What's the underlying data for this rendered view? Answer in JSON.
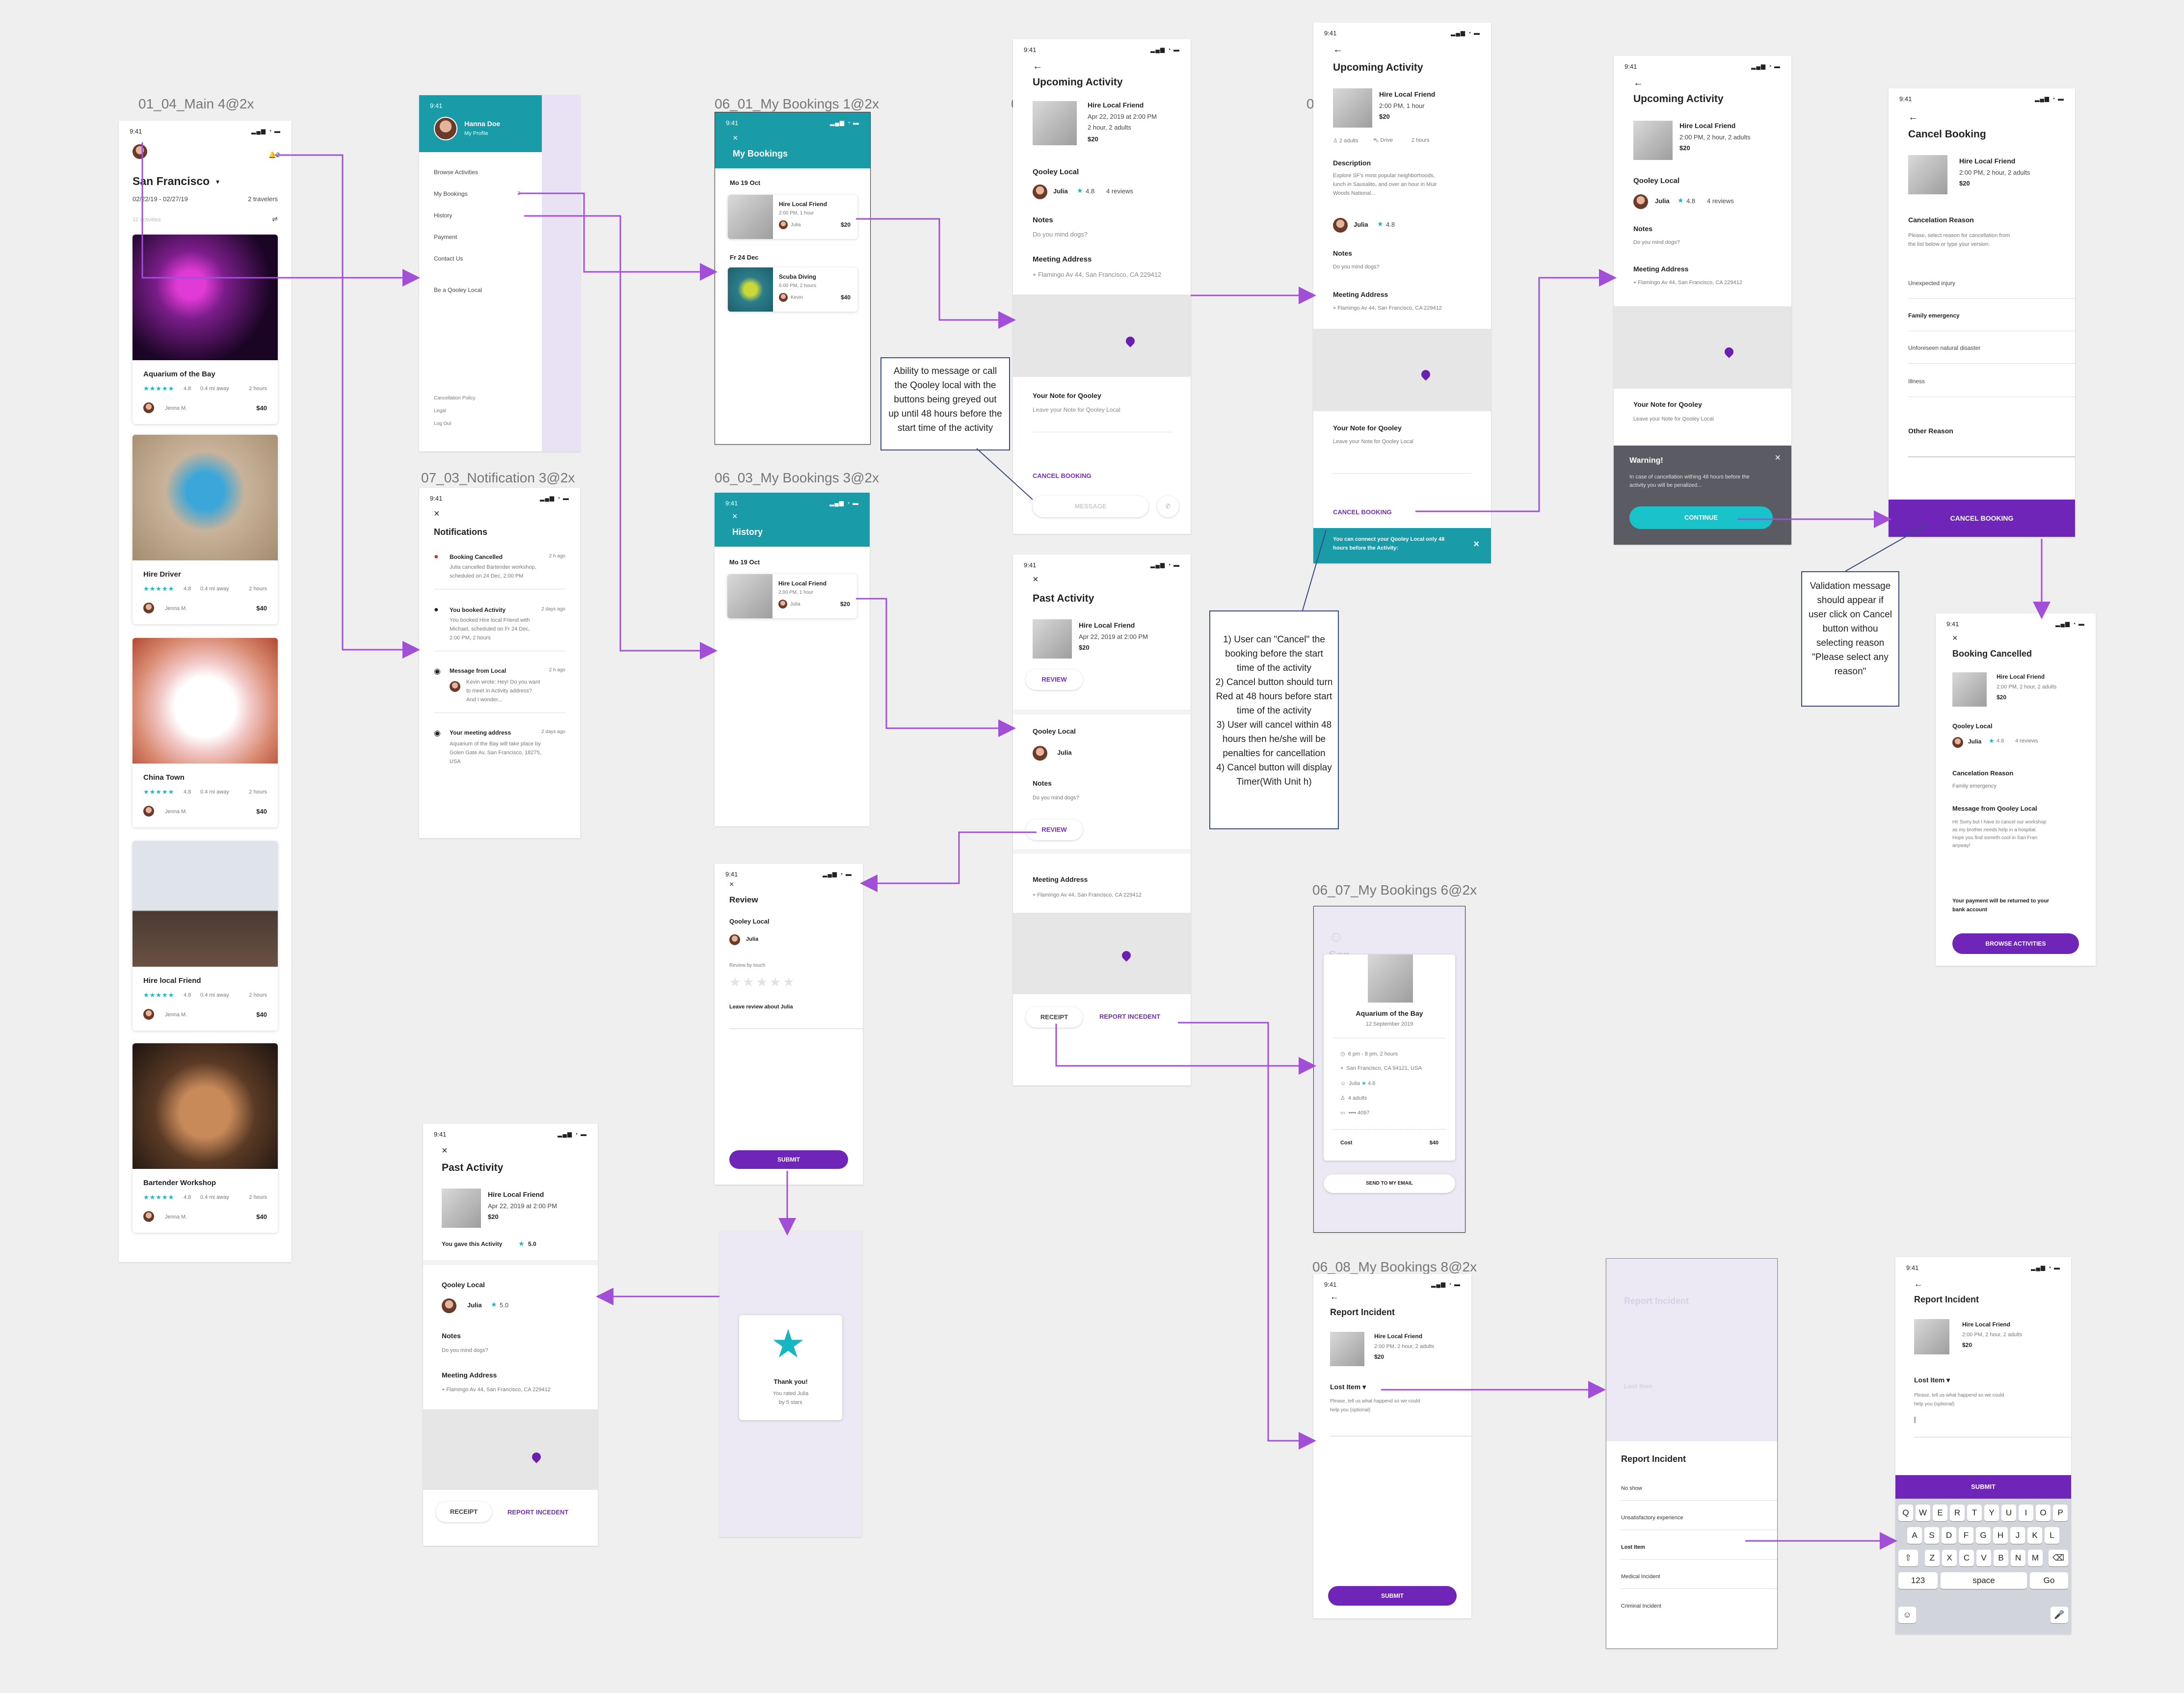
{
  "labels": {
    "main": "01_04_Main 4@2x",
    "b1": "06_01_My Bookings 1@2x",
    "notif": "07_03_Notification 3@2x",
    "b3": "06_03_My Bookings 3@2x",
    "b6": "06_07_My Bookings 6@2x",
    "b8": "06_08_My Bookings 8@2x",
    "stray1": "0",
    "stray2": "0"
  },
  "common": {
    "time": "9:41",
    "signal": "▂▄▆ ◔ ▬",
    "hire_local": "Hire Local Friend",
    "qooley_local": "Qooley Local",
    "julia": "Julia",
    "rating": "4.8",
    "reviews": "4 reviews",
    "notes": "Notes",
    "notes_q": "Do you mind dogs?",
    "meeting": "Meeting Address",
    "address": "Flamingo Av 44, San Francisco, CA 229412",
    "note_for": "Your Note for Qooley",
    "note_ph": "Leave your Note for Qooley Local",
    "cancel_booking": "CANCEL BOOKING",
    "message": "MESSAGE",
    "receipt": "RECEIPT",
    "report_incident": "REPORT INCEDENT",
    "review": "REVIEW",
    "submit": "SUBMIT",
    "price": "$20",
    "back": "←",
    "close": "×"
  },
  "main": {
    "city": "San Francisco",
    "dates": "02/22/19 - 02/27/19",
    "travelers": "2 travelers",
    "activities_count": "12 activities",
    "bell_count": "2",
    "cards": [
      {
        "title": "Aquarium of the Bay",
        "rating": "4.8",
        "dist": "0.4 mi away",
        "dur": "2 hours",
        "host": "Jenna M.",
        "price": "$40"
      },
      {
        "title": "Hire Driver",
        "rating": "4.8",
        "dist": "0.4 mi away",
        "dur": "2 hours",
        "host": "Jenna M.",
        "price": "$40"
      },
      {
        "title": "China Town",
        "rating": "4.8",
        "dist": "0.4 mi away",
        "dur": "2 hours",
        "host": "Jenna M.",
        "price": "$40"
      },
      {
        "title": "Hire local Friend",
        "rating": "4.8",
        "dist": "0.4 mi away",
        "dur": "2 hours",
        "host": "Jenna M.",
        "price": "$40"
      },
      {
        "title": "Bartender Workshop",
        "rating": "4.8",
        "dist": "0.4 mi away",
        "dur": "2 hours",
        "host": "Jenna M.",
        "price": "$40"
      }
    ]
  },
  "menu": {
    "name": "Hanna Doe",
    "profile": "My Profile",
    "items": [
      "Browse Activities",
      "My Bookings",
      "History",
      "Payment",
      "Contact Us",
      "Be a Qooley Local"
    ],
    "badge": "2",
    "footer": [
      "Cancellation Policy",
      "Legal",
      "Log Out"
    ]
  },
  "bookings1": {
    "title": "My Bookings",
    "d1": "Mo 19 Oct",
    "i1_title": "Hire Local Friend",
    "i1_time": "2:00 PM, 1 hour",
    "i1_host": "Julia",
    "i1_price": "$20",
    "d2": "Fr 24 Dec",
    "i2_title": "Scuba Diving",
    "i2_time": "6:00 PM, 2 hours",
    "i2_host": "Kevin",
    "i2_price": "$40"
  },
  "notifications": {
    "title": "Notifications",
    "items": [
      {
        "title": "Booking Cancelled",
        "time": "2 h ago",
        "body1": "Julia cancelled Bartender workshop,",
        "body2": "scheduled on 24 Dec, 2:00 PM"
      },
      {
        "title": "You booked Activity",
        "time": "2 days ago",
        "body1": "You booked Hire local Friend with",
        "body2": "Michael, scheduled on Fr 24 Dec,",
        "body3": "2:00 PM, 2 hours"
      },
      {
        "title": "Message from Local",
        "time": "2 h ago",
        "body1": "Kevin wrote: Hey! Do you want",
        "body2": "to meet in Activity address?",
        "body3": "And I wonder..."
      },
      {
        "title": "Your meeting address",
        "time": "2 days ago",
        "body1": "Aquarium of the Bay will take place by",
        "body2": "Golen Gate Av, San Francisco, 18275,",
        "body3": "USA"
      }
    ]
  },
  "history": {
    "title": "History",
    "d1": "Mo 19 Oct",
    "i1_title": "Hire Local Friend",
    "i1_time": "2:00 PM, 1 hour",
    "i1_host": "Julia",
    "i1_price": "$20"
  },
  "upcoming1": {
    "title": "Upcoming Activity",
    "date": "Apr 22, 2019 at 2:00 PM",
    "dur": "2 hour, 2 adults"
  },
  "upcoming2": {
    "title": "Upcoming Activity",
    "time": "2:00 PM, 1 hour",
    "adults": "2 adults",
    "drive": "Drive",
    "hours": "2 hours",
    "desc_h": "Description",
    "desc1": "Explore SF's most popular neighborhoods,",
    "desc2": "lunch in Sausalito, and over an hour in Muir",
    "desc3": "Woods National...",
    "toast": "You can connect your Qooley Local only 48 hours before the Activity:"
  },
  "upcoming3": {
    "title": "Upcoming Activity",
    "time": "2:00 PM, 2 hour, 2 adults",
    "warn_title": "Warning!",
    "warn_body": "In case of cancellation withing 48 hours before the activity you will be penalized...",
    "continue": "CONTINUE"
  },
  "cancel": {
    "title": "Cancel Booking",
    "time": "2:00 PM, 2 hour, 2 adults",
    "reason_h": "Cancelation Reason",
    "reason_p1": "Please, select reason for cancellation from",
    "reason_p2": "the list below or type your version:",
    "reasons": [
      "Unexpected injury",
      "Family emergency",
      "Unforeseen natural disaster",
      "Illness"
    ],
    "other": "Other Reason"
  },
  "cancelled": {
    "title": "Booking Cancelled",
    "time": "2:00 PM, 2 hour, 2 adults",
    "reason_h": "Cancelation Reason",
    "reason": "Family emergency",
    "msg_h": "Message from Qooley Local",
    "msg1": "Hi! Sorry but I have to cancel our workshop",
    "msg2": "as my brother needs help in a hospital.",
    "msg3": "Hope you find someth cool in San Fran",
    "msg4": "anyway!",
    "refund1": "Your payment will be returned to your",
    "refund2": "bank account",
    "browse": "BROWSE ACTIVITIES"
  },
  "past1": {
    "title": "Past Activity",
    "date": "Apr 22, 2019 at 2:00 PM"
  },
  "past2": {
    "title": "Past Activity",
    "date": "Apr 22, 2019 at 2:00 PM",
    "gave": "You gave this Activity",
    "score": "5.0"
  },
  "review": {
    "title": "Review",
    "by": "Review by touch",
    "leave": "Leave review about Julia"
  },
  "thanks": {
    "t1": "Thank you!",
    "t2": "You rated Julia",
    "t3": "by 5 stars"
  },
  "ticket": {
    "title": "Aquarium of the Bay",
    "date": "12 September 2019",
    "time": "6 pm - 8 pm, 2 hours",
    "addr": "San Francisco, CA 94121, USA",
    "host": "Julia",
    "adults": "4 adults",
    "card": "•••• 4097",
    "cost_l": "Cost",
    "cost": "$40",
    "send": "SEND TO MY EMAIL",
    "bg": "San"
  },
  "report1": {
    "title": "Report Incident",
    "time": "2:00 PM, 2 hour, 2 adults",
    "lost": "Lost Item",
    "lost_p1": "Please, tell us what happend so we could",
    "lost_p2": "help you (optional)"
  },
  "reportlist": {
    "title": "Report Incident",
    "items": [
      "No show",
      "Unsatisfactory experience",
      "Lost Item",
      "Medical Incident",
      "Criminal Incident"
    ],
    "bg_title": "Report Incident",
    "bg_lost": "Lost Item"
  },
  "report2": {
    "title": "Report Incident",
    "time": "2:00 PM, 2 hour, 2 adults",
    "lost": "Lost Item",
    "lost_p1": "Please, tell us what happend so we could",
    "lost_p2": "help you (optional)",
    "row1": [
      "Q",
      "W",
      "E",
      "R",
      "T",
      "Y",
      "U",
      "I",
      "O",
      "P"
    ],
    "row2": [
      "A",
      "S",
      "D",
      "F",
      "G",
      "H",
      "J",
      "K",
      "L"
    ],
    "row3": [
      "Z",
      "X",
      "C",
      "V",
      "B",
      "N",
      "M"
    ],
    "k123": "123",
    "space": "space",
    "go": "Go"
  },
  "annotations": {
    "a1": "Ability to message or call the Qooley local with the buttons being greyed out up until 48 hours before the start time of the activity",
    "a2": "1) User can \"Cancel\" the booking before the start time of the activity\n2) Cancel  button should turn Red at 48 hours before start time of the activity\n3) User will cancel within 48 hours then he/she will be penalties for cancellation\n4) Cancel button will display Timer(With Unit h)",
    "a3": "Validation message should appear if user click on Cancel button withou selecting reason \"Please select any reason\""
  }
}
